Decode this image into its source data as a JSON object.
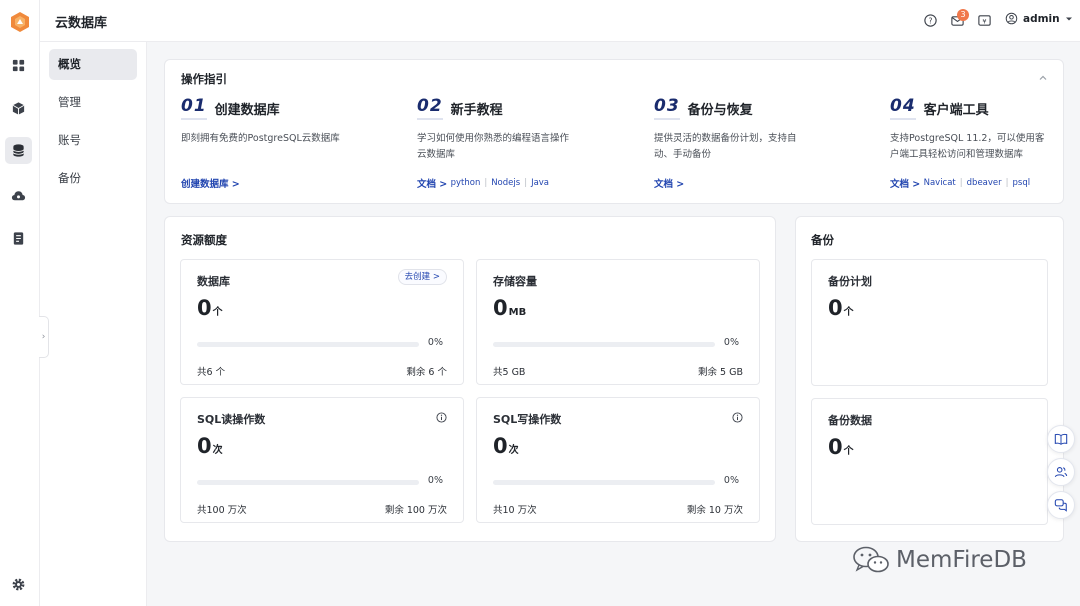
{
  "header": {
    "app_title": "云数据库",
    "notification_count": "3",
    "username": "admin"
  },
  "sidebar": {
    "icons": [
      "dashboard-icon",
      "cube-icon",
      "database-icon",
      "cloud-icon",
      "document-icon",
      "settings-icon"
    ],
    "active_icon": "database-icon"
  },
  "nav": {
    "items": [
      {
        "label": "概览",
        "active": true
      },
      {
        "label": "管理",
        "active": false
      },
      {
        "label": "账号",
        "active": false
      },
      {
        "label": "备份",
        "active": false
      }
    ]
  },
  "guide": {
    "title": "操作指引",
    "steps": [
      {
        "num": "01",
        "title": "创建数据库",
        "desc": "即刻拥有免费的PostgreSQL云数据库",
        "link": "创建数据库 >",
        "subs": []
      },
      {
        "num": "02",
        "title": "新手教程",
        "desc": "学习如何使用你熟悉的编程语言操作云数据库",
        "link": "文档 >",
        "subs": [
          "python",
          "Nodejs",
          "Java"
        ]
      },
      {
        "num": "03",
        "title": "备份与恢复",
        "desc": "提供灵活的数据备份计划，支持自动、手动备份",
        "link": "文档 >",
        "subs": []
      },
      {
        "num": "04",
        "title": "客户端工具",
        "desc": "支持PostgreSQL 11.2，可以使用客户端工具轻松访问和管理数据库",
        "link": "文档 >",
        "subs": [
          "Navicat",
          "dbeaver",
          "psql"
        ]
      }
    ]
  },
  "quota": {
    "title": "资源额度",
    "cards": [
      {
        "label": "数据库",
        "value": "0",
        "unit": "个",
        "percent": "0%",
        "progress": 0,
        "total": "共6 个",
        "remaining": "剩余 6 个",
        "action": "去创建 >"
      },
      {
        "label": "存储容量",
        "value": "0",
        "unit": "MB",
        "percent": "0%",
        "progress": 0,
        "total": "共5 GB",
        "remaining": "剩余 5 GB"
      },
      {
        "label": "SQL读操作数",
        "value": "0",
        "unit": "次",
        "percent": "0%",
        "progress": 0,
        "total": "共100 万次",
        "remaining": "剩余 100 万次"
      },
      {
        "label": "SQL写操作数",
        "value": "0",
        "unit": "次",
        "percent": "0%",
        "progress": 0,
        "total": "共10 万次",
        "remaining": "剩余 10 万次"
      }
    ]
  },
  "backup": {
    "title": "备份",
    "cards": [
      {
        "label": "备份计划",
        "value": "0",
        "unit": "个"
      },
      {
        "label": "备份数据",
        "value": "0",
        "unit": "个"
      }
    ]
  },
  "watermark": "MemFireDB",
  "colors": {
    "accent": "#3b5bdb",
    "link": "#2346b0",
    "badge": "#f0784b",
    "step_number": "#1a2c6e"
  }
}
